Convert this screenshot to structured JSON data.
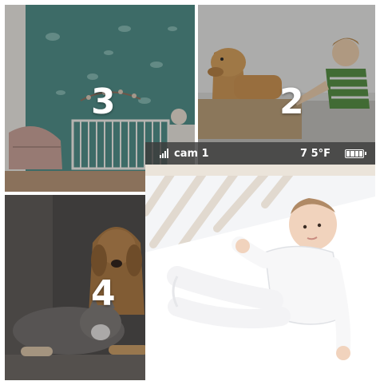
{
  "tiles": [
    {
      "id": "3",
      "label": "3",
      "scene": "nursery"
    },
    {
      "id": "2",
      "label": "2",
      "scene": "dog-and-child"
    },
    {
      "id": "4",
      "label": "4",
      "scene": "dog-and-cat"
    }
  ],
  "main_cam": {
    "name": "cam 1",
    "temperature": "7 5°F",
    "signal_icon": "signal-bars-icon",
    "battery_icon": "battery-full-icon",
    "battery_level": 1.0,
    "scene": "baby-in-crib"
  },
  "colors": {
    "tile_number": "#ffffff",
    "status_bar": "#3c3c3c",
    "nursery_wall": "#4f8f88",
    "crib_sheet": "#f4f5f7"
  }
}
